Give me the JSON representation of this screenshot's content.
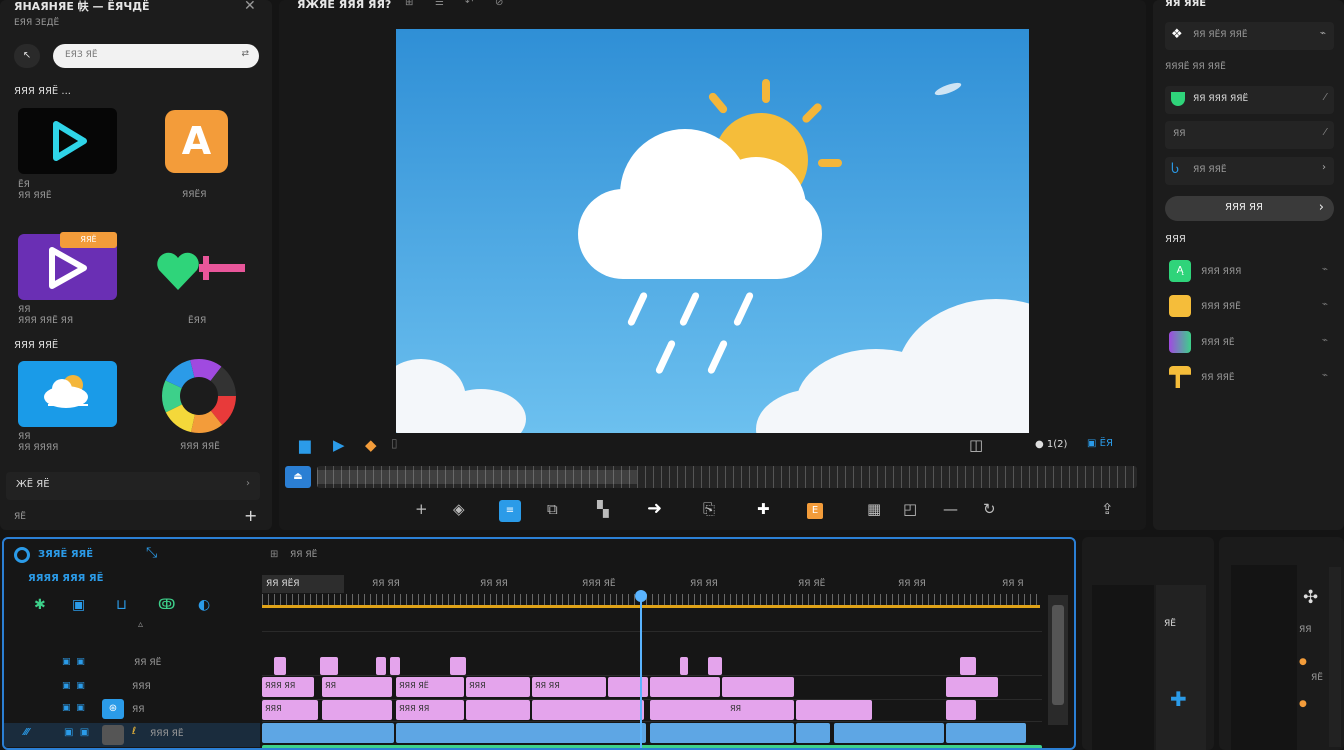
{
  "left_panel": {
    "title": "ЯНАЯНЯЕ 㠸 — ЁЯЧДЁ",
    "subtitle": "ЕЯЯ ЗЕДЁ",
    "search_placeholder": "ЕЯЗ ЯЁ",
    "section_a": "ЯЯЯ ЯЯЁ ...",
    "section_b": "ЯЯЯ ЯЯЁ",
    "items": [
      {
        "label": "ЁЯ\nЯЯ ЯЯЁ"
      },
      {
        "label": "ЯЯЁЯ"
      },
      {
        "label": "ЯЯ\nЯЯЯ ЯЯЁ ЯЯ",
        "badge": "ЯЯЁ"
      },
      {
        "label": "ЁЯЯ"
      },
      {
        "label": "ЯЯ\nЯЯ ЯЯЯЯ"
      },
      {
        "label": "ЯЯЯ ЯЯЁ"
      }
    ],
    "footer_label": "ЖЁ ЯЁ",
    "footer2_label": "ЯЁ"
  },
  "center": {
    "title": "ЯЖЯЁ ЯЯЯ ЯЯ?",
    "timecode": "1(2)",
    "bottom_label": "ЁЯ"
  },
  "right_panel": {
    "title": "ЯЯ ЯЯЁ",
    "row1": "ЯЯ ЯЁЯ ЯЯЁ",
    "label1": "ЯЯЯЁ ЯЯ ЯЯЁ",
    "row2": "ЯЯ ЯЯЯ ЯЯЁ",
    "row3": "ЯЯ",
    "row4": "ЯЯ ЯЯЁ",
    "pill": "ЯЯЯ ЯЯ",
    "section": "ЯЯЯ",
    "list": [
      "ЯЯЯ ЯЯЯ",
      "ЯЯЯ ЯЯЁ",
      "ЯЯЯ ЯЁ",
      "ЯЯ ЯЯЁ"
    ]
  },
  "timeline": {
    "title": "ЗЯЯЁ ЯЯЁ",
    "subtitle": "ЯЯЯЯ ЯЯЯ ЯЁ",
    "tab": "ЯЯ ЯЁ",
    "ruler_labels": [
      "ЯЯ ЯЁЯ",
      "ЯЯ ЯЯ",
      "ЯЯ ЯЯ",
      "ЯЯЯ ЯЁ",
      "ЯЯ ЯЯ",
      "ЯЯ ЯЁ",
      "ЯЯ ЯЯ",
      "ЯЯ Я"
    ],
    "track_labels": [
      "ЯЯ ЯЁ",
      "ЯЯЯ",
      "ЯЯ",
      "ЯЯЯ ЯЁ"
    ],
    "clip_labels": [
      "ЯЯЯ ЯЯ",
      "ЯЯ",
      "ЯЯЯ ЯЁ",
      "ЯЯЯ",
      "ЯЯ ЯЯ",
      "ЯЯЯ",
      "ЯЯЯ ЯЯ",
      "ЯЯ"
    ]
  },
  "mini1": {
    "label": "ЯЁ"
  },
  "mini2": {
    "label": "ЯЯ",
    "label2": "ЯЁ"
  },
  "colors": {
    "accent": "#2b7fd4",
    "pink_clip": "#e4a4ec",
    "blue_clip": "#5ea6e4",
    "green_clip": "#3dd08a",
    "orange": "#f39c3a"
  }
}
